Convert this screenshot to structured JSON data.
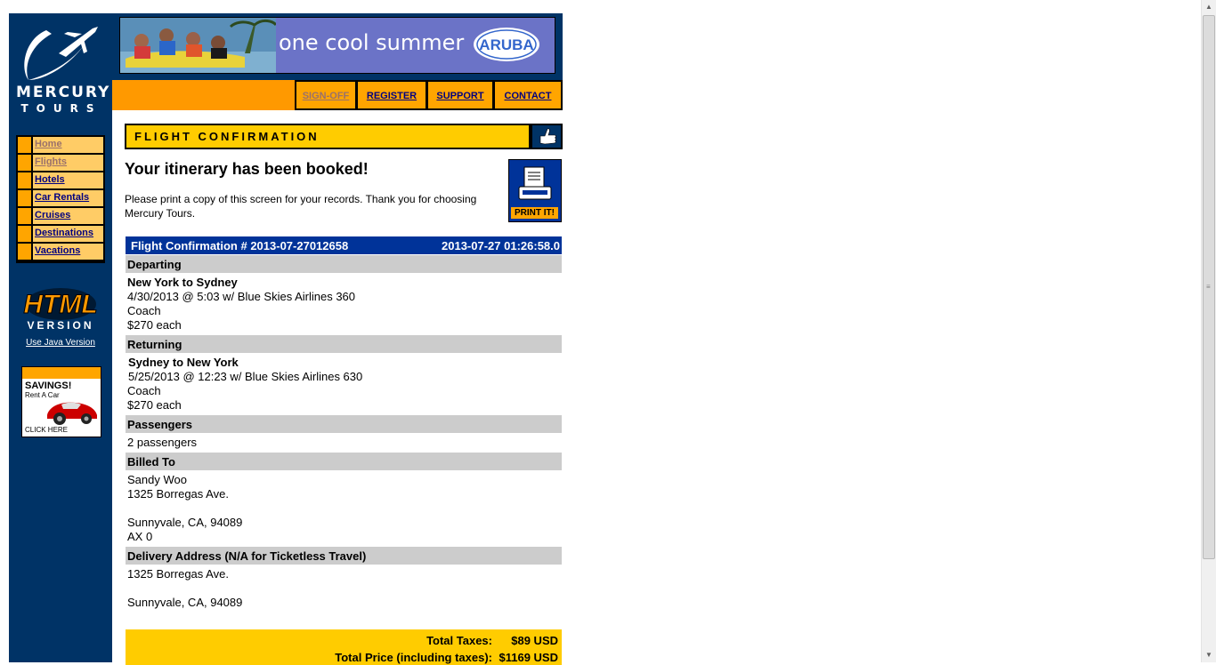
{
  "logo": {
    "line1": "MERCURY",
    "line2": "TOURS"
  },
  "sidebar": {
    "items": [
      {
        "label": "Home",
        "visited": true
      },
      {
        "label": "Flights",
        "visited": true
      },
      {
        "label": "Hotels",
        "visited": false
      },
      {
        "label": "Car Rentals",
        "visited": false
      },
      {
        "label": "Cruises",
        "visited": false
      },
      {
        "label": "Destinations",
        "visited": false
      },
      {
        "label": "Vacations",
        "visited": false
      }
    ],
    "html_badge": {
      "line1": "HTML",
      "line2": "VERSION"
    },
    "java_link": "Use Java Version",
    "ad": {
      "headline": "SAVINGS!",
      "sub": "Rent A Car",
      "cta": "CLICK HERE"
    }
  },
  "banner": {
    "text": "one cool summer",
    "logo": "ARUBA"
  },
  "topnav": [
    {
      "label": "SIGN-OFF",
      "visited": true
    },
    {
      "label": "REGISTER",
      "visited": false
    },
    {
      "label": "SUPPORT",
      "visited": false
    },
    {
      "label": "CONTACT",
      "visited": false
    }
  ],
  "confirmation": {
    "header": "FLIGHT CONFIRMATION",
    "itinerary_title": "Your itinerary has been booked!",
    "print_note": "Please print a copy of this screen for your records. Thank you for choosing Mercury Tours.",
    "print_label": "PRINT IT!",
    "number": "Flight Confirmation # 2013-07-27012658",
    "timestamp": "2013-07-27 01:26:58.0",
    "departing": {
      "label": "Departing",
      "route": "New York to Sydney",
      "detail": "4/30/2013 @ 5:03 w/ Blue Skies Airlines 360",
      "class": "Coach",
      "price": "$270 each"
    },
    "returning": {
      "label": "Returning",
      "route": "Sydney to New York",
      "detail": "5/25/2013 @ 12:23 w/ Blue Skies Airlines 630",
      "class": "Coach",
      "price": "$270 each"
    },
    "passengers": {
      "label": "Passengers",
      "value": "2 passengers"
    },
    "billed_to": {
      "label": "Billed To",
      "name": "Sandy Woo",
      "street": "1325 Borregas Ave.",
      "city": "Sunnyvale, CA, 94089",
      "card": "AX 0"
    },
    "delivery": {
      "label": "Delivery Address (N/A for Ticketless Travel)",
      "street": "1325 Borregas Ave.",
      "city": "Sunnyvale, CA, 94089"
    },
    "totals": {
      "taxes_label": "Total Taxes:",
      "taxes_value": "$89 USD",
      "price_label": "Total Price (including taxes):",
      "price_value": "$1169 USD"
    }
  },
  "colors": {
    "sidebar_bg": "#003366",
    "accent_orange": "#ffa500",
    "header_yellow": "#ffcc00",
    "link_blue": "#000080",
    "confirmation_blue": "#003399"
  }
}
